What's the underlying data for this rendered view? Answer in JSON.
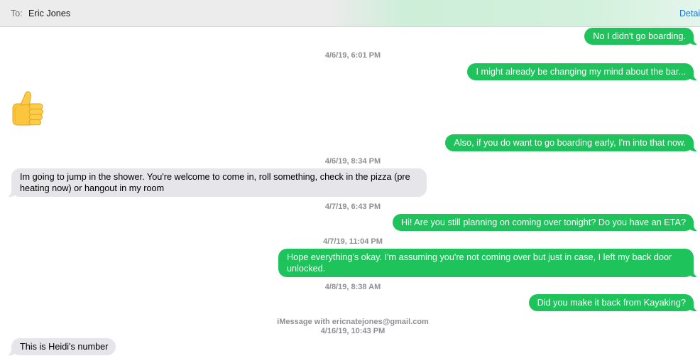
{
  "header": {
    "to_label": "To:",
    "recipient": "Eric Jones",
    "details_label": "Detai"
  },
  "theme": {
    "sent_bubble": "#1ec45b",
    "received_bubble": "#e5e5ea",
    "timestamp_text": "#8e8e93",
    "details_link": "#1b76d3"
  },
  "conversation": [
    {
      "sent": "No I didn't go boarding."
    },
    {
      "timestamp": "4/6/19, 6:01 PM"
    },
    {
      "sent": "I might already be changing my mind about the bar..."
    },
    {
      "received_icon": "thumbs-up-icon"
    },
    {
      "sent": "Also, if you do want to go boarding early, I'm into that now."
    },
    {
      "timestamp": "4/6/19, 8:34 PM"
    },
    {
      "received": "Im going to jump in the shower. You're welcome to come in, roll something, check in the pizza (pre heating now) or hangout in my room"
    },
    {
      "timestamp": "4/7/19, 6:43 PM"
    },
    {
      "sent": "Hi! Are you still planning on coming over tonight? Do you have an ETA?"
    },
    {
      "timestamp": "4/7/19, 11:04 PM"
    },
    {
      "sent": "Hope everything's okay. I'm assuming you're not coming over but just in case, I left my back door unlocked."
    },
    {
      "timestamp": "4/8/19, 8:38 AM"
    },
    {
      "sent": "Did you make it back from Kayaking?"
    },
    {
      "service": "iMessage with ericnatejones@gmail.com"
    },
    {
      "timestamp": "4/16/19, 10:43 PM"
    },
    {
      "received": "This is Heidi's number"
    }
  ]
}
